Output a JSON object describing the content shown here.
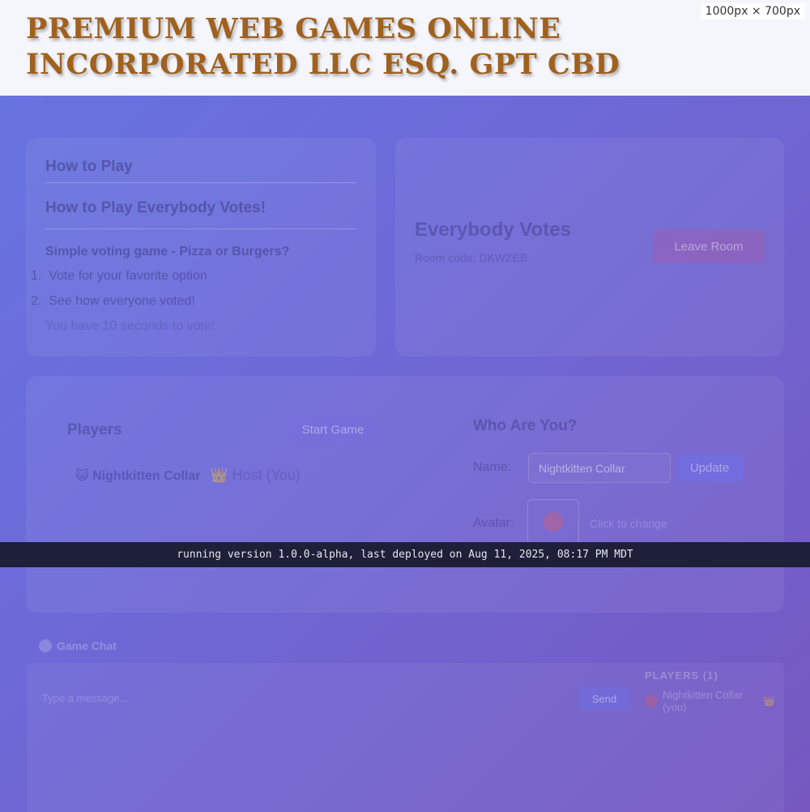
{
  "site": {
    "title": "PREMIUM WEB GAMES ONLINE INCORPORATED LLC ESQ. GPT CBD"
  },
  "viewport_tag": "1000px × 700px",
  "how_to_play": {
    "heading": "How to Play",
    "subheading": "How to Play Everybody Votes!",
    "intro": "Simple voting game - Pizza or Burgers?",
    "steps": [
      "Vote for your favorite option",
      "See how everyone voted!"
    ],
    "note": "You have 10 seconds to vote!"
  },
  "game": {
    "name": "Everybody Votes",
    "room_code": "Room code: DKWZEB",
    "leave_label": "Leave Room"
  },
  "players": {
    "heading": "Players",
    "start_label": "Start Game",
    "list": [
      {
        "name": "Nightkitten Collar",
        "tag": "Host (You)"
      }
    ]
  },
  "profile": {
    "heading": "Who Are You?",
    "name_label": "Name:",
    "name_value": "Nightkitten Collar",
    "update_label": "Update",
    "avatar_label": "Avatar:",
    "avatar_action": "Click to change"
  },
  "version": {
    "text": "running version 1.0.0-alpha, last deployed on Aug 11, 2025, 08:17 PM MDT"
  },
  "chat": {
    "title": "Game Chat",
    "placeholder": "Type a message...",
    "send_label": "Send",
    "players_title": "PLAYERS (1)",
    "players": [
      {
        "name": "Nightkitten Collar (you)"
      }
    ]
  },
  "colors": {
    "accent": "#a0611e",
    "bar_bg": "#1e1f38",
    "gradient_start": "#6675e0",
    "gradient_end": "#7658c0"
  }
}
